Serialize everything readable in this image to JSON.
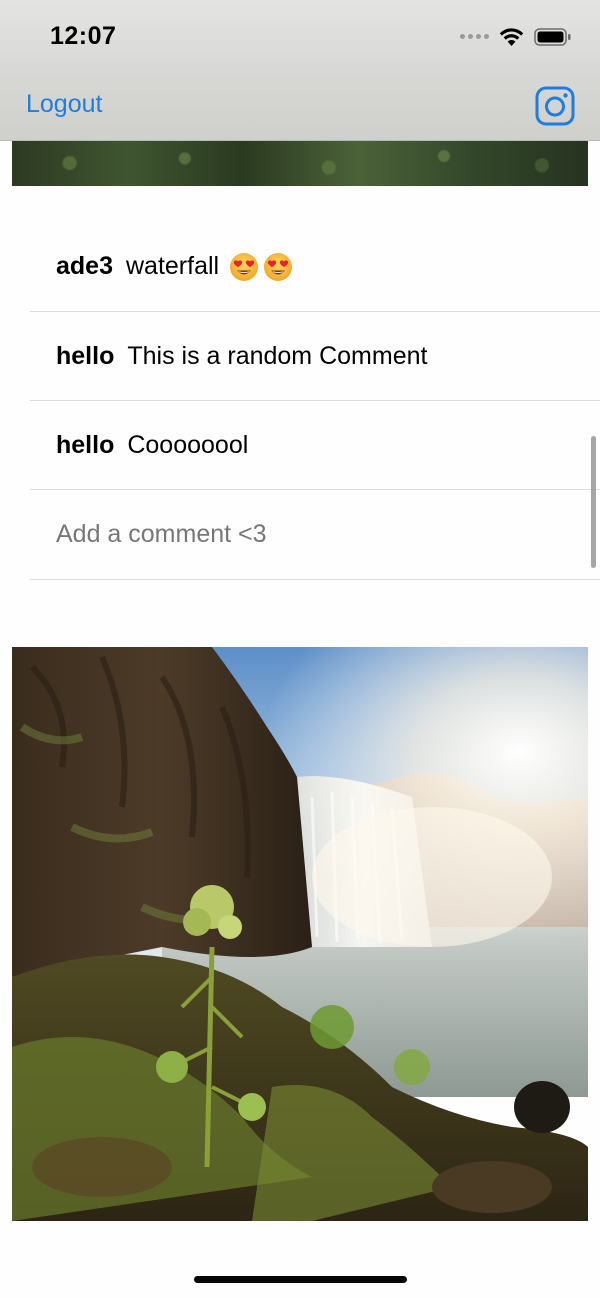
{
  "status_bar": {
    "time": "12:07",
    "icons": [
      "cellular-signal-icon",
      "wifi-icon",
      "battery-icon"
    ]
  },
  "nav": {
    "logout_label": "Logout",
    "camera_icon": "instagram-camera-icon"
  },
  "colors": {
    "accent": "#1e7ee0",
    "divider": "#dcdcdc",
    "placeholder": "#777777"
  },
  "comments": [
    {
      "username": "ade3",
      "text": "waterfall",
      "emoji": [
        "heart-eyes-emoji",
        "heart-eyes-emoji"
      ]
    },
    {
      "username": "hello",
      "text": "This is a random Comment"
    },
    {
      "username": "hello",
      "text": "Coooooool"
    }
  ],
  "comment_input": {
    "placeholder": "Add a comment <3"
  },
  "post_image": {
    "subject": "waterfall-photo"
  }
}
